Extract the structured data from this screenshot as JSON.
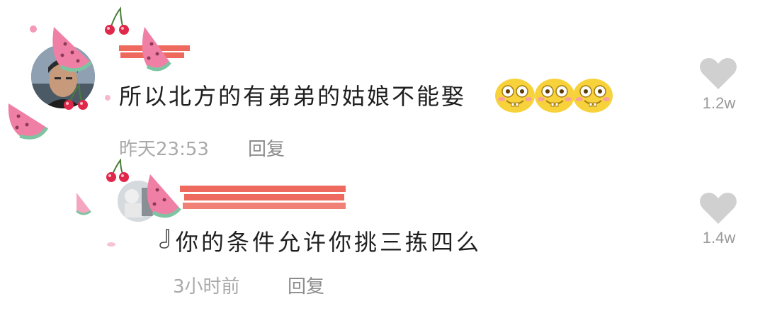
{
  "top_cutoff": "— — —",
  "comments": [
    {
      "text": "所以北方的有弟弟的姑娘不能娶",
      "time": "昨天23:53",
      "reply_label": "回复",
      "likes": "1.2w",
      "emoji_count": 3
    },
    {
      "text": "你的条件允许你挑三拣四么",
      "time": "3小时前",
      "reply_label": "回复",
      "likes": "1.4w"
    }
  ],
  "icons": {
    "like": "heart-icon",
    "emoji": "laughing-face-emoji",
    "decoration": [
      "watermelon-icon",
      "cherry-icon"
    ]
  },
  "colors": {
    "text": "#1f1f1f",
    "meta": "#a9a9a9",
    "like": "#d0d0d0",
    "redaction": "#ee6a5e",
    "watermelon": "#f07fa5"
  }
}
